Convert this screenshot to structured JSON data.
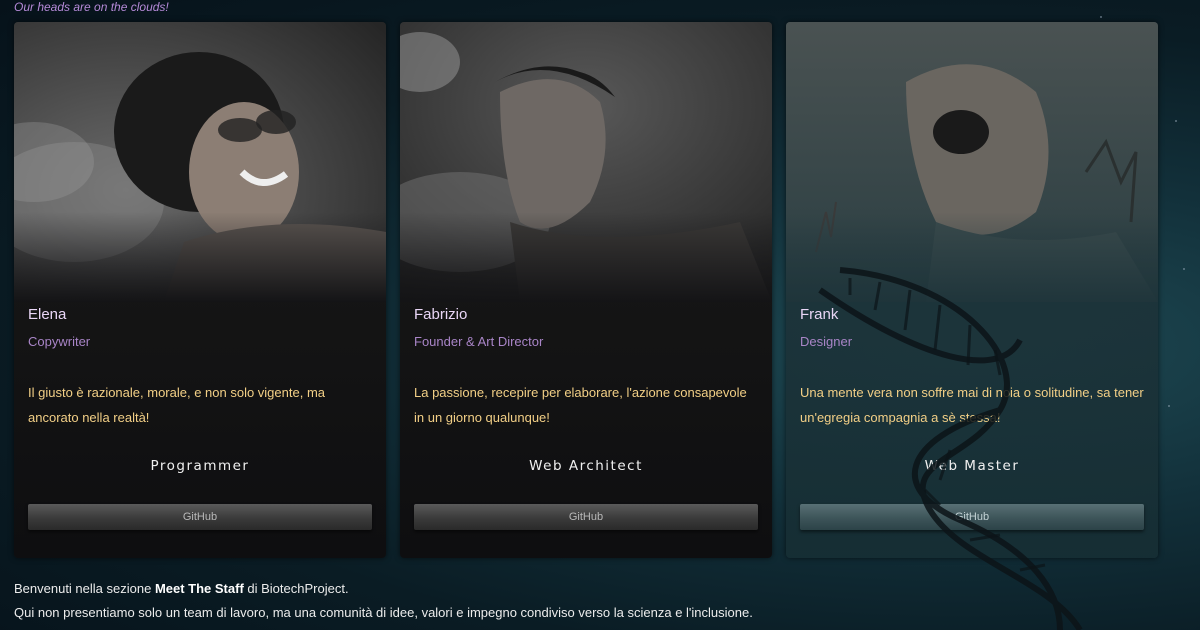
{
  "tagline": "Our heads are on the clouds!",
  "staff": [
    {
      "name": "Elena",
      "role": "Copywriter",
      "quote": "Il giusto è razionale, morale, e non solo vigente, ma ancorato nella realtà!",
      "job": "Programmer",
      "github": "GitHub"
    },
    {
      "name": "Fabrizio",
      "role": "Founder & Art Director",
      "quote": "La passione, recepire per elaborare, l'azione consapevole in un giorno qualunque!",
      "job": "Web Architect",
      "github": "GitHub"
    },
    {
      "name": "Frank",
      "role": "Designer",
      "quote": "Una mente vera non soffre mai di noia o solitudine, sa tener un'egregia compagnia a sè stessa!",
      "job": "Web Master",
      "github": "GitHub"
    }
  ],
  "intro": {
    "line1_prefix": "Benvenuti nella sezione ",
    "line1_bold": "Meet The Staff",
    "line1_suffix": " di BiotechProject.",
    "line2": "Qui non presentiamo solo un team di lavoro, ma una comunità di idee, valori e impegno condiviso verso la scienza e l'inclusione."
  },
  "colors": {
    "accent_purple": "#b58ad8",
    "quote_gold": "#f2cf86",
    "background": "#0a1c24"
  }
}
